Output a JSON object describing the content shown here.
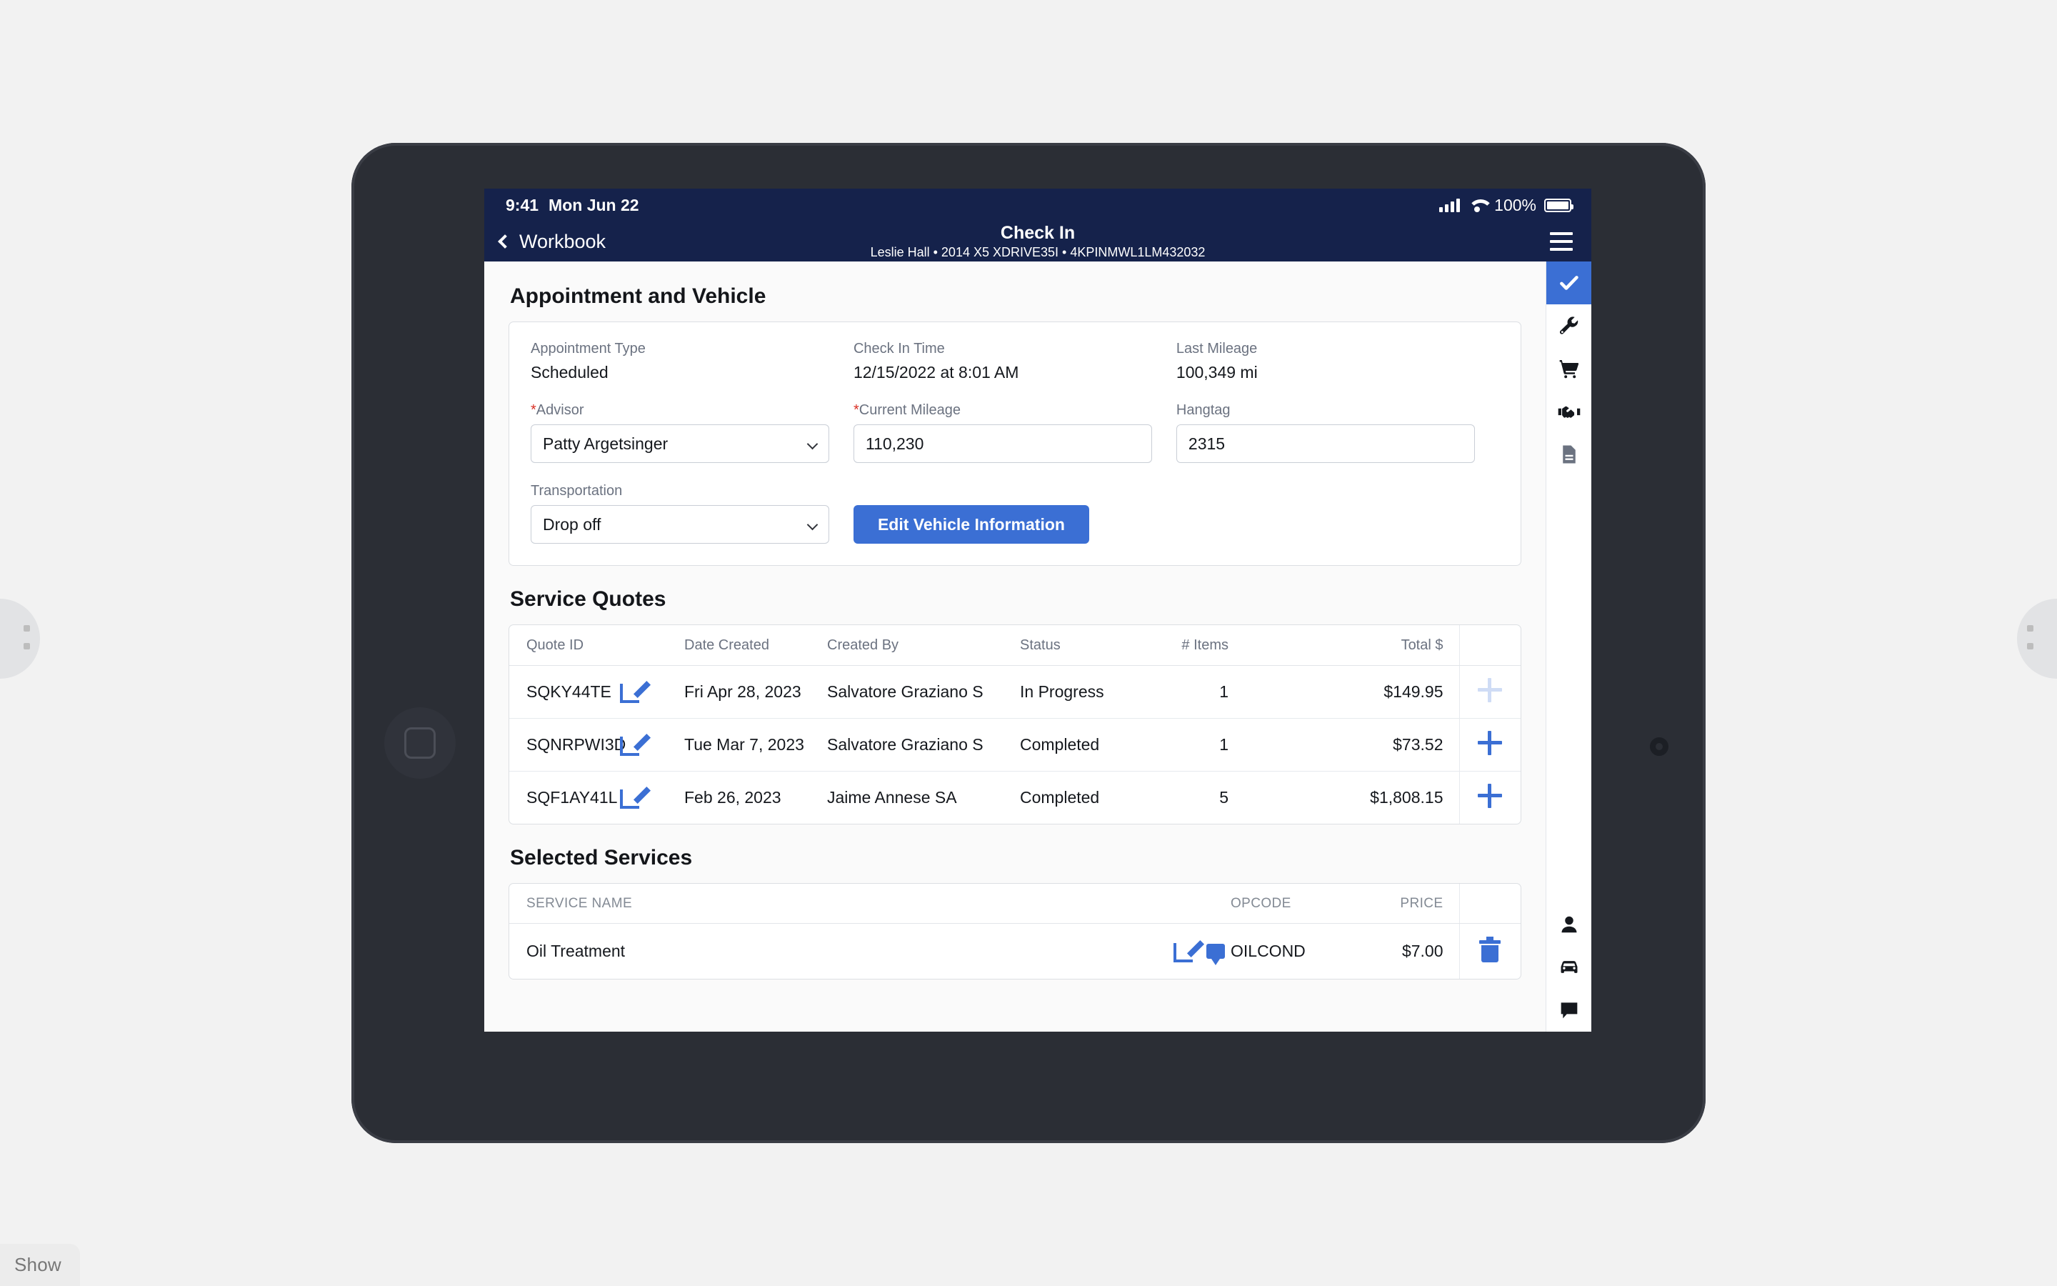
{
  "page": {
    "show_label": "Show"
  },
  "status_bar": {
    "time": "9:41",
    "date": "Mon Jun 22",
    "battery_percent": "100%",
    "cellular_icon": "cellular-signal-icon",
    "wifi_icon": "wifi-icon",
    "battery_icon": "battery-full-icon"
  },
  "nav": {
    "back_label": "Workbook",
    "back_icon": "chevron-left-icon",
    "title": "Check In",
    "subtitle": "Leslie Hall • 2014 X5 XDRIVE35I • 4KPINMWL1LM432032",
    "menu_icon": "hamburger-menu-icon"
  },
  "appointment": {
    "heading": "Appointment and Vehicle",
    "appointment_type_label": "Appointment Type",
    "appointment_type_value": "Scheduled",
    "check_in_time_label": "Check In Time",
    "check_in_time_value": "12/15/2022 at 8:01 AM",
    "last_mileage_label": "Last Mileage",
    "last_mileage_value": "100,349 mi",
    "advisor_label": "Advisor",
    "advisor_required": "*",
    "advisor_value": "Patty Argetsinger",
    "current_mileage_label": "Current Mileage",
    "current_mileage_required": "*",
    "current_mileage_value": "110,230",
    "hangtag_label": "Hangtag",
    "hangtag_value": "2315",
    "transportation_label": "Transportation",
    "transportation_value": "Drop off",
    "edit_vehicle_button": "Edit Vehicle Information"
  },
  "service_quotes": {
    "heading": "Service Quotes",
    "columns": {
      "quote_id": "Quote ID",
      "date_created": "Date Created",
      "created_by": "Created By",
      "status": "Status",
      "items": "# Items",
      "total": "Total $"
    },
    "rows": [
      {
        "quote_id": "SQKY44TE",
        "date_created": "Fri Apr 28, 2023",
        "created_by": "Salvatore Graziano S",
        "status": "In Progress",
        "items": "1",
        "total": "$149.95",
        "add_enabled": false
      },
      {
        "quote_id": "SQNRPWI3D",
        "date_created": "Tue Mar 7, 2023",
        "created_by": "Salvatore Graziano S",
        "status": "Completed",
        "items": "1",
        "total": "$73.52",
        "add_enabled": true
      },
      {
        "quote_id": "SQF1AY41L",
        "date_created": "Feb 26, 2023",
        "created_by": "Jaime Annese SA",
        "status": "Completed",
        "items": "5",
        "total": "$1,808.15",
        "add_enabled": true
      }
    ]
  },
  "selected_services": {
    "heading": "Selected Services",
    "columns": {
      "service_name": "SERVICE NAME",
      "opcode": "OPCODE",
      "price": "PRICE"
    },
    "rows": [
      {
        "service_name": "Oil Treatment",
        "opcode": "OILCOND",
        "price": "$7.00"
      }
    ]
  },
  "rail": {
    "items": [
      {
        "name": "checkmark-icon",
        "active": true
      },
      {
        "name": "wrench-icon",
        "active": false
      },
      {
        "name": "shopping-cart-icon",
        "active": false
      },
      {
        "name": "handshake-icon",
        "active": false
      },
      {
        "name": "document-icon",
        "active": false
      }
    ],
    "bottom_items": [
      {
        "name": "person-icon"
      },
      {
        "name": "car-icon"
      },
      {
        "name": "chat-bubble-icon"
      }
    ]
  },
  "colors": {
    "accent_blue": "#3b6fd4",
    "navbar_navy": "#15224b",
    "required_red": "#d93025"
  }
}
